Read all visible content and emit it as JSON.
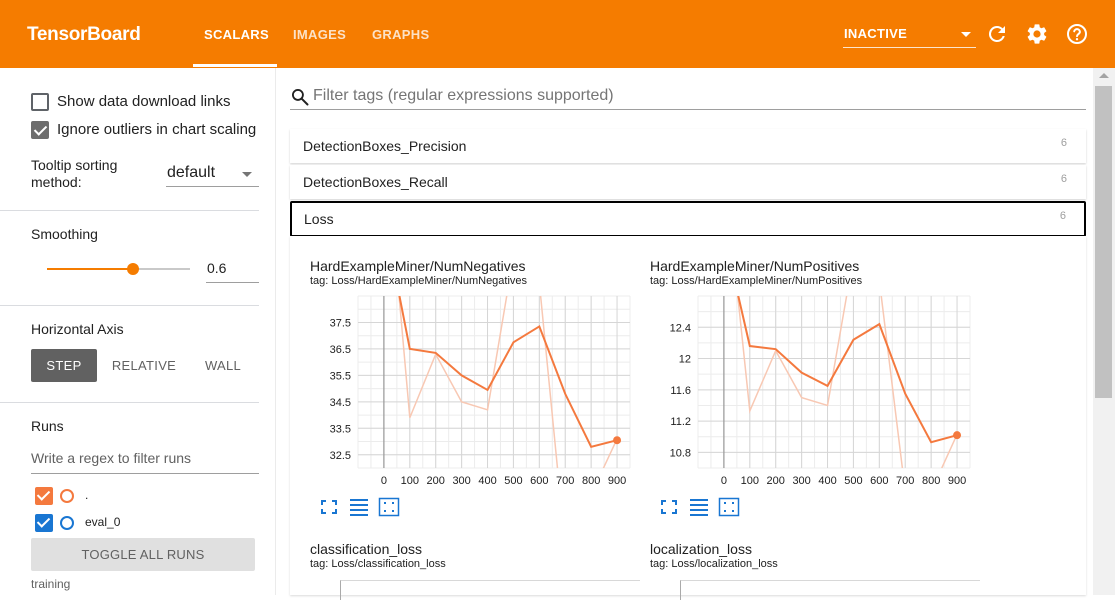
{
  "header": {
    "brand": "TensorBoard",
    "tabs": [
      {
        "label": "SCALARS",
        "active": true
      },
      {
        "label": "IMAGES",
        "active": false
      },
      {
        "label": "GRAPHS",
        "active": false
      }
    ],
    "run_select": "INACTIVE",
    "accent_color": "#f57c00"
  },
  "sidebar": {
    "show_download_links": {
      "label": "Show data download links",
      "checked": false
    },
    "ignore_outliers": {
      "label": "Ignore outliers in chart scaling",
      "checked": true
    },
    "tooltip_sorting": {
      "label": "Tooltip sorting method:",
      "value": "default"
    },
    "smoothing": {
      "title": "Smoothing",
      "value": "0.6",
      "fraction": 0.6
    },
    "horizontal_axis": {
      "title": "Horizontal Axis",
      "options": [
        {
          "label": "STEP",
          "active": true
        },
        {
          "label": "RELATIVE",
          "active": false
        },
        {
          "label": "WALL",
          "active": false
        }
      ]
    },
    "runs": {
      "title": "Runs",
      "filter_placeholder": "Write a regex to filter runs",
      "items": [
        {
          "label": ".",
          "checked": true,
          "color": "#f4793e"
        },
        {
          "label": "eval_0",
          "checked": true,
          "color": "#1976d2"
        }
      ],
      "toggle_all": "TOGGLE ALL RUNS",
      "footer": "training"
    }
  },
  "main": {
    "filter_placeholder": "Filter tags (regular expressions supported)",
    "categories": [
      {
        "name": "DetectionBoxes_Precision",
        "count": "6",
        "open": false
      },
      {
        "name": "DetectionBoxes_Recall",
        "count": "6",
        "open": false
      },
      {
        "name": "Loss",
        "count": "6",
        "open": true
      }
    ],
    "cards": [
      {
        "title": "HardExampleMiner/NumNegatives",
        "tag": "tag: Loss/HardExampleMiner/NumNegatives"
      },
      {
        "title": "HardExampleMiner/NumPositives",
        "tag": "tag: Loss/HardExampleMiner/NumPositives"
      },
      {
        "title": "classification_loss",
        "tag": "tag: Loss/classification_loss"
      },
      {
        "title": "localization_loss",
        "tag": "tag: Loss/localization_loss"
      }
    ],
    "card_tools": [
      "expand-icon",
      "list-icon",
      "fit-domain-icon"
    ]
  },
  "chart_data": [
    {
      "type": "line",
      "title": "HardExampleMiner/NumNegatives",
      "xlabel": "",
      "ylabel": "",
      "x_ticks": [
        0,
        100,
        200,
        300,
        400,
        500,
        600,
        700,
        800,
        900
      ],
      "y_ticks": [
        32.5,
        33.5,
        34.5,
        35.5,
        36.5,
        37.5
      ],
      "xlim": [
        -100,
        950
      ],
      "ylim": [
        32,
        38.5
      ],
      "grid": true,
      "series": [
        {
          "role": "smoothed",
          "color": "#f4793e",
          "x": [
            0,
            100,
            200,
            300,
            400,
            500,
            600,
            700,
            800,
            900
          ],
          "y": [
            41.5,
            36.5,
            36.35,
            35.5,
            34.95,
            36.75,
            37.35,
            34.8,
            32.8,
            33.05
          ]
        },
        {
          "role": "raw",
          "color": "#f8c8b3",
          "x": [
            0,
            100,
            200,
            300,
            400,
            500,
            600,
            700,
            800,
            900
          ],
          "y": [
            45,
            33.9,
            36.3,
            34.5,
            34.2,
            40,
            39,
            29,
            31,
            33.1
          ]
        }
      ]
    },
    {
      "type": "line",
      "title": "HardExampleMiner/NumPositives",
      "xlabel": "",
      "ylabel": "",
      "x_ticks": [
        0,
        100,
        200,
        300,
        400,
        500,
        600,
        700,
        800,
        900
      ],
      "y_ticks": [
        10.8,
        11.2,
        11.6,
        12,
        12.4
      ],
      "xlim": [
        -100,
        950
      ],
      "ylim": [
        10.6,
        12.8
      ],
      "grid": true,
      "series": [
        {
          "role": "smoothed",
          "color": "#f4793e",
          "x": [
            0,
            100,
            200,
            300,
            400,
            500,
            600,
            700,
            800,
            900
          ],
          "y": [
            13.6,
            12.16,
            12.12,
            11.82,
            11.65,
            12.24,
            12.44,
            11.55,
            10.93,
            11.02
          ]
        },
        {
          "role": "raw",
          "color": "#f8c8b3",
          "x": [
            0,
            100,
            200,
            300,
            400,
            500,
            600,
            700,
            800,
            900
          ],
          "y": [
            14.5,
            11.33,
            12.1,
            11.5,
            11.4,
            13.3,
            13,
            10.3,
            10.3,
            11.03
          ]
        }
      ]
    }
  ]
}
